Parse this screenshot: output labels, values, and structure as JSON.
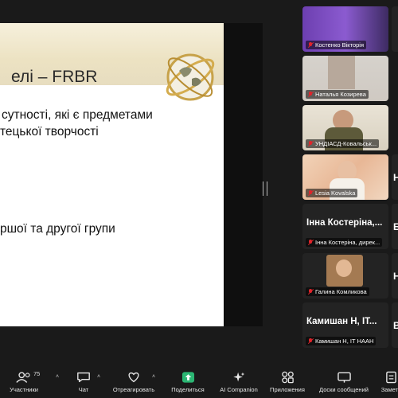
{
  "slide": {
    "title": "елі – FRBR",
    "line1": "сутності,  які  є  предметами",
    "line2": "тецької творчості",
    "line3": "ршої та другої групи"
  },
  "participants": [
    {
      "name": "Костенко Вікторія",
      "type": "video"
    },
    {
      "name": "Наталья Козирева",
      "type": "video"
    },
    {
      "name": "УНДІАСД-Ковальськ...",
      "type": "video"
    },
    {
      "name": "Lesia Kovalska",
      "type": "video"
    },
    {
      "name": "Інна Костеріна, дирек...",
      "big": "Інна Костеріна,...",
      "type": "name"
    },
    {
      "name": "Галина Комликова",
      "type": "video"
    },
    {
      "name": "Камишан Н, ІТ НААН",
      "big": "Камишан  Н, ІТ...",
      "type": "name"
    }
  ],
  "side_chars": [
    "Н",
    "Н",
    "Б",
    "Н",
    "В"
  ],
  "toolbar": {
    "participants_label": "Участники",
    "participants_count": "75",
    "chat_label": "Чат",
    "react_label": "Отреагировать",
    "share_label": "Поделиться",
    "ai_label": "AI Companion",
    "apps_label": "Приложения",
    "whiteboards_label": "Доски сообщений",
    "notes_label": "Заметк"
  },
  "colors": {
    "background": "#1a1a1a",
    "share_green": "#2bb673",
    "mute_red": "#e0242b"
  }
}
